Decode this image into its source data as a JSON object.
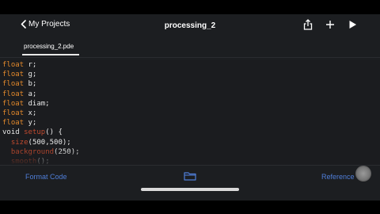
{
  "nav": {
    "back_label": "My Projects",
    "title": "processing_2"
  },
  "tab": {
    "label": "processing_2.pde"
  },
  "code_lines": [
    [
      {
        "t": "float",
        "c": "kw"
      },
      {
        "t": " r;",
        "c": ""
      }
    ],
    [
      {
        "t": "float",
        "c": "kw"
      },
      {
        "t": " g;",
        "c": ""
      }
    ],
    [
      {
        "t": "float",
        "c": "kw"
      },
      {
        "t": " b;",
        "c": ""
      }
    ],
    [
      {
        "t": "float",
        "c": "kw"
      },
      {
        "t": " a;",
        "c": ""
      }
    ],
    [
      {
        "t": "float",
        "c": "kw"
      },
      {
        "t": " diam;",
        "c": ""
      }
    ],
    [
      {
        "t": "float",
        "c": "kw"
      },
      {
        "t": " x;",
        "c": ""
      }
    ],
    [
      {
        "t": "float",
        "c": "kw"
      },
      {
        "t": " y;",
        "c": ""
      }
    ],
    [
      {
        "t": "void ",
        "c": ""
      },
      {
        "t": "setup",
        "c": "fn"
      },
      {
        "t": "() {",
        "c": ""
      }
    ],
    [
      {
        "t": "  ",
        "c": ""
      },
      {
        "t": "size",
        "c": "fn"
      },
      {
        "t": "(500,500);",
        "c": ""
      }
    ],
    [
      {
        "t": "  ",
        "c": ""
      },
      {
        "t": "background",
        "c": "fn"
      },
      {
        "t": "(250);",
        "c": ""
      }
    ],
    [
      {
        "t": "  ",
        "c": ""
      },
      {
        "t": "smooth",
        "c": "fn"
      },
      {
        "t": "();",
        "c": ""
      }
    ]
  ],
  "toolbar": {
    "format_label": "Format Code",
    "reference_label": "Reference"
  },
  "colors": {
    "accent": "#4f7ed8",
    "keyword": "#e48a2c",
    "function": "#c04a2f",
    "background": "#1c1e21"
  }
}
